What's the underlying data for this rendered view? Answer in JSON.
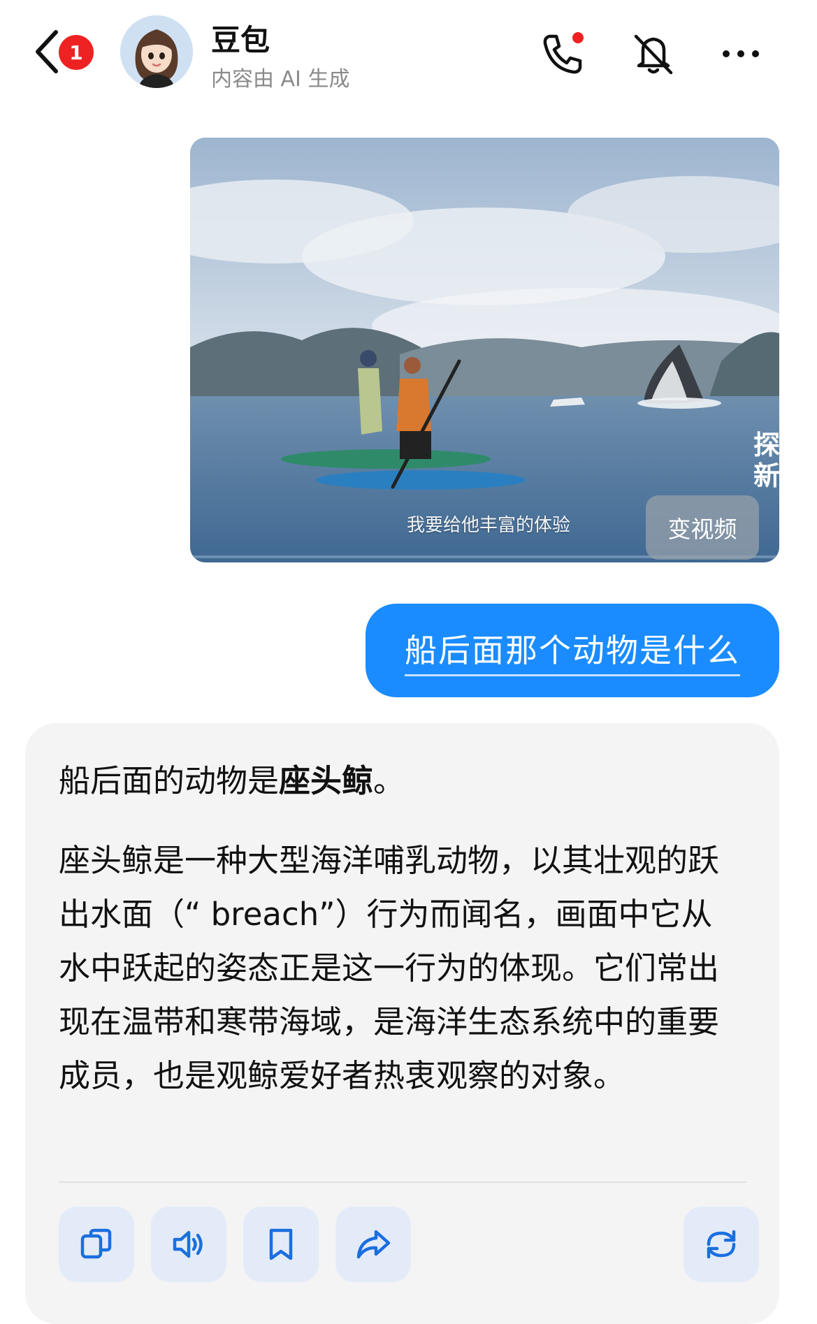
{
  "header": {
    "unread_count": "1",
    "contact_name": "豆包",
    "contact_subtitle": "内容由 AI 生成"
  },
  "image_message": {
    "subtitle_text": "我要给他丰富的体验",
    "to_video_label": "变视频",
    "watermark": "探\n新"
  },
  "user_message": {
    "text": "船后面那个动物是什么"
  },
  "ai_message": {
    "first_line_prefix": "船后面的动物是",
    "first_line_bold": "座头鲸",
    "first_line_suffix": "。",
    "paragraph": "座头鲸是一种大型海洋哺乳动物，以其壮观的跃出水面（“ breach”）行为而闻名，画面中它从水中跃起的姿态正是这一行为的体现。它们常出现在温带和寒带海域，是海洋生态系统中的重要成员，也是观鲸爱好者热衷观察的对象。"
  },
  "actions": {
    "icons": [
      "copy-icon",
      "speaker-icon",
      "bookmark-icon",
      "share-icon",
      "refresh-icon"
    ]
  },
  "colors": {
    "accent_blue": "#1a8cff",
    "badge_red": "#ee2222",
    "card_bg": "#f4f4f5",
    "action_bg": "#e4ebf8"
  }
}
